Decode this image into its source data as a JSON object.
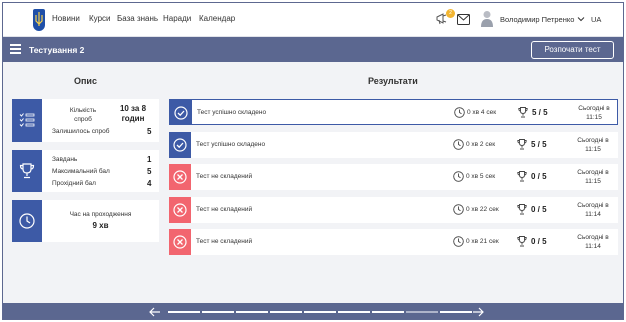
{
  "nav": {
    "items": [
      "Новини",
      "Курси",
      "База знань",
      "Наради",
      "Календар"
    ],
    "notification_count": "2",
    "user_name": "Володимир Петренко",
    "language": "UA"
  },
  "titlebar": {
    "title": "Тестування 2",
    "start_button": "Розпочати тест"
  },
  "sections": {
    "description_heading": "Опис",
    "results_heading": "Результати"
  },
  "info": {
    "attempts_label": "Кількість спроб",
    "attempts_value": "10 за 8 годин",
    "remaining_label": "Залишилось спроб",
    "remaining_value": "5",
    "tasks_label": "Завдань",
    "tasks_value": "1",
    "max_score_label": "Максимальний бал",
    "max_score_value": "5",
    "pass_score_label": "Прохідний бал",
    "pass_score_value": "4",
    "duration_label": "Час на проходження",
    "duration_value": "9 хв"
  },
  "results": [
    {
      "status": "passed",
      "label": "Тест успішно складено",
      "time": "0 хв 4 сек",
      "score": "5 / 5",
      "date_line1": "Сьогодні в",
      "date_line2": "11:15"
    },
    {
      "status": "passed",
      "label": "Тест успішно складено",
      "time": "0 хв 2 сек",
      "score": "5 / 5",
      "date_line1": "Сьогодні в",
      "date_line2": "11:15"
    },
    {
      "status": "failed",
      "label": "Тест не складений",
      "time": "0 хв 5 сек",
      "score": "0 / 5",
      "date_line1": "Сьогодні в",
      "date_line2": "11:15"
    },
    {
      "status": "failed",
      "label": "Тест не складений",
      "time": "0 хв 22 сек",
      "score": "0 / 5",
      "date_line1": "Сьогодні в",
      "date_line2": "11:14"
    },
    {
      "status": "failed",
      "label": "Тест не складений",
      "time": "0 хв 21 сек",
      "score": "0 / 5",
      "date_line1": "Сьогодні в",
      "date_line2": "11:14"
    }
  ],
  "pagination": {
    "total_pages": 9,
    "current_page": 8
  },
  "colors": {
    "header": "#5b6790",
    "accent": "#3d5aa6",
    "fail": "#f2656f",
    "badge": "#f2b531"
  }
}
